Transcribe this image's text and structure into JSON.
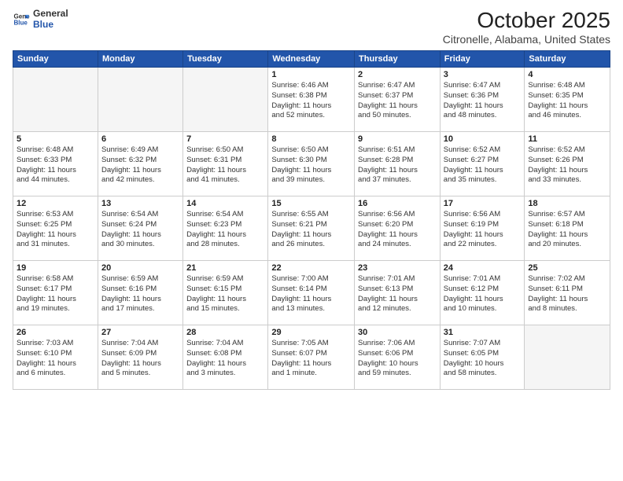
{
  "logo": {
    "general": "General",
    "blue": "Blue"
  },
  "header": {
    "month": "October 2025",
    "location": "Citronelle, Alabama, United States"
  },
  "weekdays": [
    "Sunday",
    "Monday",
    "Tuesday",
    "Wednesday",
    "Thursday",
    "Friday",
    "Saturday"
  ],
  "weeks": [
    [
      {
        "day": "",
        "info": ""
      },
      {
        "day": "",
        "info": ""
      },
      {
        "day": "",
        "info": ""
      },
      {
        "day": "1",
        "info": "Sunrise: 6:46 AM\nSunset: 6:38 PM\nDaylight: 11 hours\nand 52 minutes."
      },
      {
        "day": "2",
        "info": "Sunrise: 6:47 AM\nSunset: 6:37 PM\nDaylight: 11 hours\nand 50 minutes."
      },
      {
        "day": "3",
        "info": "Sunrise: 6:47 AM\nSunset: 6:36 PM\nDaylight: 11 hours\nand 48 minutes."
      },
      {
        "day": "4",
        "info": "Sunrise: 6:48 AM\nSunset: 6:35 PM\nDaylight: 11 hours\nand 46 minutes."
      }
    ],
    [
      {
        "day": "5",
        "info": "Sunrise: 6:48 AM\nSunset: 6:33 PM\nDaylight: 11 hours\nand 44 minutes."
      },
      {
        "day": "6",
        "info": "Sunrise: 6:49 AM\nSunset: 6:32 PM\nDaylight: 11 hours\nand 42 minutes."
      },
      {
        "day": "7",
        "info": "Sunrise: 6:50 AM\nSunset: 6:31 PM\nDaylight: 11 hours\nand 41 minutes."
      },
      {
        "day": "8",
        "info": "Sunrise: 6:50 AM\nSunset: 6:30 PM\nDaylight: 11 hours\nand 39 minutes."
      },
      {
        "day": "9",
        "info": "Sunrise: 6:51 AM\nSunset: 6:28 PM\nDaylight: 11 hours\nand 37 minutes."
      },
      {
        "day": "10",
        "info": "Sunrise: 6:52 AM\nSunset: 6:27 PM\nDaylight: 11 hours\nand 35 minutes."
      },
      {
        "day": "11",
        "info": "Sunrise: 6:52 AM\nSunset: 6:26 PM\nDaylight: 11 hours\nand 33 minutes."
      }
    ],
    [
      {
        "day": "12",
        "info": "Sunrise: 6:53 AM\nSunset: 6:25 PM\nDaylight: 11 hours\nand 31 minutes."
      },
      {
        "day": "13",
        "info": "Sunrise: 6:54 AM\nSunset: 6:24 PM\nDaylight: 11 hours\nand 30 minutes."
      },
      {
        "day": "14",
        "info": "Sunrise: 6:54 AM\nSunset: 6:23 PM\nDaylight: 11 hours\nand 28 minutes."
      },
      {
        "day": "15",
        "info": "Sunrise: 6:55 AM\nSunset: 6:21 PM\nDaylight: 11 hours\nand 26 minutes."
      },
      {
        "day": "16",
        "info": "Sunrise: 6:56 AM\nSunset: 6:20 PM\nDaylight: 11 hours\nand 24 minutes."
      },
      {
        "day": "17",
        "info": "Sunrise: 6:56 AM\nSunset: 6:19 PM\nDaylight: 11 hours\nand 22 minutes."
      },
      {
        "day": "18",
        "info": "Sunrise: 6:57 AM\nSunset: 6:18 PM\nDaylight: 11 hours\nand 20 minutes."
      }
    ],
    [
      {
        "day": "19",
        "info": "Sunrise: 6:58 AM\nSunset: 6:17 PM\nDaylight: 11 hours\nand 19 minutes."
      },
      {
        "day": "20",
        "info": "Sunrise: 6:59 AM\nSunset: 6:16 PM\nDaylight: 11 hours\nand 17 minutes."
      },
      {
        "day": "21",
        "info": "Sunrise: 6:59 AM\nSunset: 6:15 PM\nDaylight: 11 hours\nand 15 minutes."
      },
      {
        "day": "22",
        "info": "Sunrise: 7:00 AM\nSunset: 6:14 PM\nDaylight: 11 hours\nand 13 minutes."
      },
      {
        "day": "23",
        "info": "Sunrise: 7:01 AM\nSunset: 6:13 PM\nDaylight: 11 hours\nand 12 minutes."
      },
      {
        "day": "24",
        "info": "Sunrise: 7:01 AM\nSunset: 6:12 PM\nDaylight: 11 hours\nand 10 minutes."
      },
      {
        "day": "25",
        "info": "Sunrise: 7:02 AM\nSunset: 6:11 PM\nDaylight: 11 hours\nand 8 minutes."
      }
    ],
    [
      {
        "day": "26",
        "info": "Sunrise: 7:03 AM\nSunset: 6:10 PM\nDaylight: 11 hours\nand 6 minutes."
      },
      {
        "day": "27",
        "info": "Sunrise: 7:04 AM\nSunset: 6:09 PM\nDaylight: 11 hours\nand 5 minutes."
      },
      {
        "day": "28",
        "info": "Sunrise: 7:04 AM\nSunset: 6:08 PM\nDaylight: 11 hours\nand 3 minutes."
      },
      {
        "day": "29",
        "info": "Sunrise: 7:05 AM\nSunset: 6:07 PM\nDaylight: 11 hours\nand 1 minute."
      },
      {
        "day": "30",
        "info": "Sunrise: 7:06 AM\nSunset: 6:06 PM\nDaylight: 10 hours\nand 59 minutes."
      },
      {
        "day": "31",
        "info": "Sunrise: 7:07 AM\nSunset: 6:05 PM\nDaylight: 10 hours\nand 58 minutes."
      },
      {
        "day": "",
        "info": ""
      }
    ]
  ]
}
